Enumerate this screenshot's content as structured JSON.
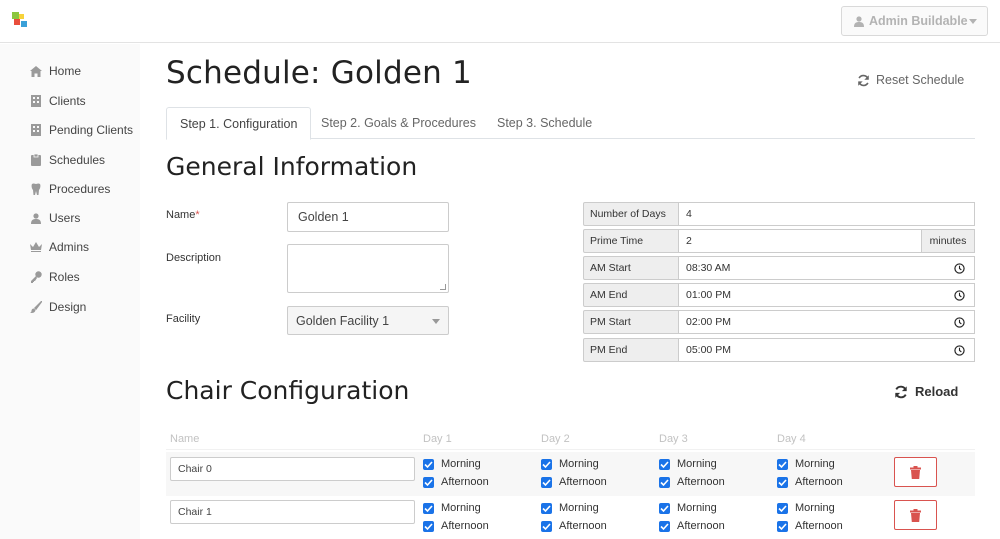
{
  "header": {
    "user_name": "Admin Buildable"
  },
  "sidebar": {
    "items": [
      {
        "label": "Home",
        "icon": "home-icon"
      },
      {
        "label": "Clients",
        "icon": "building-icon"
      },
      {
        "label": "Pending Clients",
        "icon": "building-icon"
      },
      {
        "label": "Schedules",
        "icon": "clipboard-icon"
      },
      {
        "label": "Procedures",
        "icon": "tooth-icon"
      },
      {
        "label": "Users",
        "icon": "user-icon"
      },
      {
        "label": "Admins",
        "icon": "crown-icon"
      },
      {
        "label": "Roles",
        "icon": "key-icon"
      },
      {
        "label": "Design",
        "icon": "brush-icon"
      }
    ]
  },
  "page": {
    "title": "Schedule: Golden 1",
    "reset_label": "Reset Schedule",
    "tabs": [
      {
        "label": "Step 1. Configuration",
        "active": true
      },
      {
        "label": "Step 2. Goals & Procedures",
        "active": false
      },
      {
        "label": "Step 3. Schedule",
        "active": false
      }
    ]
  },
  "general": {
    "title": "General Information",
    "name_label": "Name",
    "required_mark": "*",
    "name_value": "Golden 1",
    "description_label": "Description",
    "description_value": "",
    "facility_label": "Facility",
    "facility_value": "Golden Facility 1"
  },
  "settings": {
    "number_of_days_label": "Number of Days",
    "number_of_days_value": "4",
    "prime_time_label": "Prime Time",
    "prime_time_value": "2",
    "prime_time_unit": "minutes",
    "am_start_label": "AM Start",
    "am_start_value": "08:30 AM",
    "am_end_label": "AM End",
    "am_end_value": "01:00 PM",
    "pm_start_label": "PM Start",
    "pm_start_value": "02:00 PM",
    "pm_end_label": "PM End",
    "pm_end_value": "05:00 PM"
  },
  "chairs": {
    "title": "Chair Configuration",
    "reload_label": "Reload",
    "columns": [
      "Name",
      "Day 1",
      "Day 2",
      "Day 3",
      "Day 4"
    ],
    "morning_label": "Morning",
    "afternoon_label": "Afternoon",
    "rows": [
      {
        "name": "Chair 0",
        "days": [
          [
            true,
            true
          ],
          [
            true,
            true
          ],
          [
            true,
            true
          ],
          [
            true,
            true
          ]
        ]
      },
      {
        "name": "Chair 1",
        "days": [
          [
            true,
            true
          ],
          [
            true,
            true
          ],
          [
            true,
            true
          ],
          [
            true,
            true
          ]
        ]
      }
    ]
  },
  "colors": {
    "accent": "#1a73e8",
    "danger": "#d9534f",
    "logo_green": "#8cc63f",
    "logo_yellow": "#f7d33b",
    "logo_red": "#e94e3c",
    "logo_blue": "#3aa0d8"
  }
}
